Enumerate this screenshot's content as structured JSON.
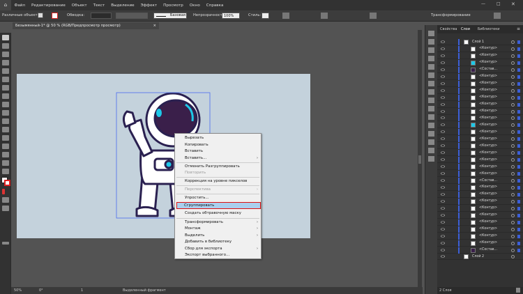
{
  "menubar": {
    "items": [
      "Файл",
      "Редактирование",
      "Объект",
      "Текст",
      "Выделение",
      "Эффект",
      "Просмотр",
      "Окно",
      "Справка"
    ]
  },
  "control_bar": {
    "selection_label": "Различные объекты",
    "stroke_label": "Обводка:",
    "brush_label": "Базовая",
    "opacity_label": "Непрозрачность:",
    "opacity_value": "100%",
    "style_label": "Стиль:",
    "transform_label": "Трансформирование"
  },
  "document": {
    "tab_title": "Безымянный-1* @ 50 % (RGB/Предпросмотр просмотр)",
    "close": "×"
  },
  "status": {
    "zoom": "50%",
    "rotation": "0°",
    "page": "1",
    "mode": "Выделенный фрагмент"
  },
  "context_menu": {
    "items": [
      {
        "label": "Вырезать",
        "disabled": false,
        "submenu": false
      },
      {
        "label": "Копировать",
        "disabled": false,
        "submenu": false
      },
      {
        "label": "Вставить",
        "disabled": false,
        "submenu": false
      },
      {
        "label": "Вставить...",
        "disabled": false,
        "submenu": true
      },
      {
        "label": "Отменить Разгруппировать",
        "disabled": false,
        "submenu": false
      },
      {
        "label": "Повторить",
        "disabled": true,
        "submenu": false
      },
      {
        "label": "Коррекция на уровне пикселов",
        "disabled": false,
        "submenu": false
      },
      {
        "label": "Перспектива",
        "disabled": true,
        "submenu": true
      },
      {
        "label": "Упростить...",
        "disabled": false,
        "submenu": false
      },
      {
        "label": "Сгруппировать",
        "disabled": false,
        "submenu": false,
        "highlighted": true
      },
      {
        "label": "Создать обтравочную маску",
        "disabled": false,
        "submenu": false
      },
      {
        "label": "Трансформировать",
        "disabled": false,
        "submenu": true
      },
      {
        "label": "Монтаж",
        "disabled": false,
        "submenu": true
      },
      {
        "label": "Выделить",
        "disabled": false,
        "submenu": true
      },
      {
        "label": "Добавить в библиотеку",
        "disabled": false,
        "submenu": false
      },
      {
        "label": "Сбор для экспорта",
        "disabled": false,
        "submenu": true
      },
      {
        "label": "Экспорт выбранного...",
        "disabled": false,
        "submenu": false
      }
    ]
  },
  "layers_panel": {
    "tabs": [
      "Свойства",
      "Слои",
      "Библиотеки"
    ],
    "rows": [
      {
        "name": "Слой 1"
      },
      {
        "name": "<Контур>"
      },
      {
        "name": "<Контур>"
      },
      {
        "name": "<Контур>"
      },
      {
        "name": "<Состав..."
      },
      {
        "name": "<Контур>"
      },
      {
        "name": "<Контур>"
      },
      {
        "name": "<Контур>"
      },
      {
        "name": "<Контур>"
      },
      {
        "name": "<Контур>"
      },
      {
        "name": "<Контур>"
      },
      {
        "name": "<Контур>"
      },
      {
        "name": "<Контур>"
      },
      {
        "name": "<Контур>"
      },
      {
        "name": "<Контур>"
      },
      {
        "name": "<Контур>"
      },
      {
        "name": "<Контур>"
      },
      {
        "name": "<Контур>"
      },
      {
        "name": "<Контур>"
      },
      {
        "name": "<Контур>"
      },
      {
        "name": "<Состав..."
      },
      {
        "name": "<Контур>"
      },
      {
        "name": "<Контур>"
      },
      {
        "name": "<Контур>"
      },
      {
        "name": "<Контур>"
      },
      {
        "name": "<Контур>"
      },
      {
        "name": "<Контур>"
      },
      {
        "name": "<Контур>"
      },
      {
        "name": "<Контур>"
      },
      {
        "name": "<Контур>"
      },
      {
        "name": "<Состав..."
      },
      {
        "name": "Слой 2"
      }
    ],
    "footer": "2 Слоя"
  },
  "colors": {
    "accent": "#3c5fd8",
    "highlight": "#aacfee",
    "highlight_border": "#dd1111",
    "artboard": "#c4d2dc",
    "astronaut_visor": "#3a1f4a",
    "astronaut_cyan": "#1ec8e8"
  }
}
